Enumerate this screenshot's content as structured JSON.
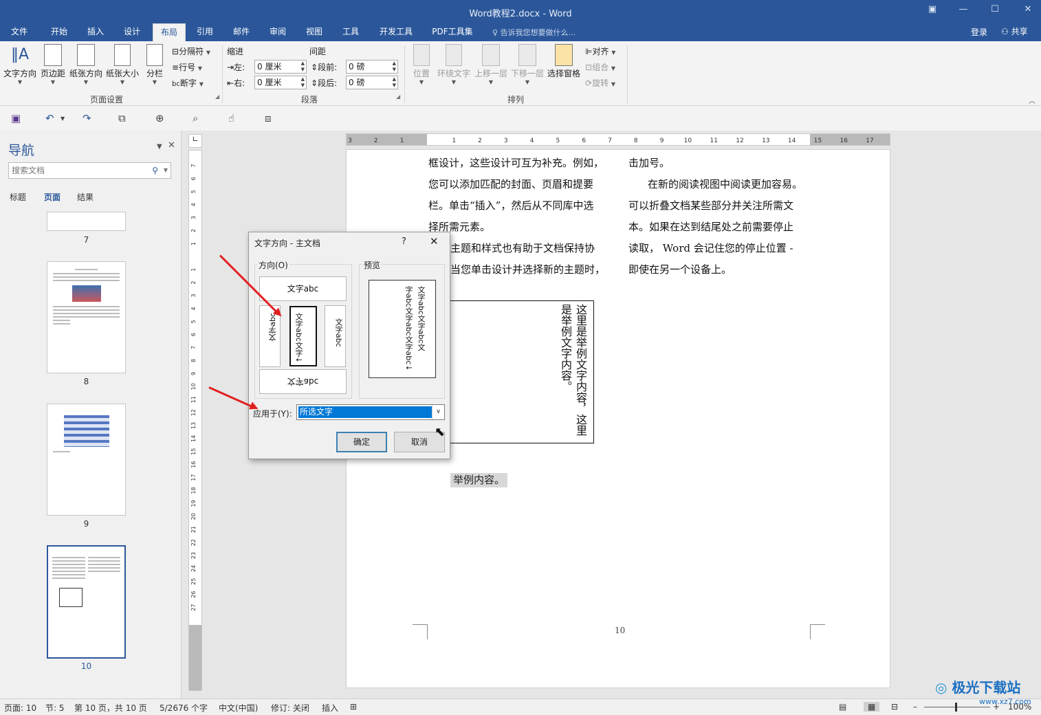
{
  "window": {
    "title": "Word教程2.docx - Word"
  },
  "tabs": [
    "文件",
    "开始",
    "插入",
    "设计",
    "布局",
    "引用",
    "邮件",
    "审阅",
    "视图",
    "工具",
    "开发工具",
    "PDF工具集"
  ],
  "tell_me": "告诉我您想要做什么...",
  "signin": "登录",
  "share": "共享",
  "ribbon": {
    "page_setup": {
      "text_direction": "文字方向",
      "margins": "页边距",
      "orientation": "纸张方向",
      "size": "纸张大小",
      "columns": "分栏",
      "breaks": "分隔符",
      "line_numbers": "行号",
      "hyphenation": "断字",
      "group": "页面设置"
    },
    "paragraph": {
      "indent": "缩进",
      "spacing": "间距",
      "left": "左:",
      "right": "右:",
      "before": "段前:",
      "after": "段后:",
      "left_val": "0 厘米",
      "right_val": "0 厘米",
      "before_val": "0 磅",
      "after_val": "0 磅",
      "group": "段落"
    },
    "arrange": {
      "position": "位置",
      "wrap": "环绕文字",
      "forward": "上移一层",
      "backward": "下移一层",
      "selection_pane": "选择窗格",
      "align": "对齐",
      "group_btn": "组合",
      "rotate": "旋转",
      "group": "排列"
    }
  },
  "nav": {
    "title": "导航",
    "search_placeholder": "搜索文档",
    "tabs": [
      "标题",
      "页面",
      "结果"
    ],
    "pages": [
      "7",
      "8",
      "9",
      "10"
    ]
  },
  "document": {
    "col1": [
      "框设计，这些设计可互为补充。例如，",
      "您可以添加匹配的封面、页眉和提要",
      "栏。单击“插入”，然后从不同库中选",
      "择所需元素。",
      "主题和样式也有助于文档保持协",
      "当您单击设计并选择新的主题时，"
    ],
    "col2": [
      "击加号。",
      "在新的阅读视图中阅读更加容易。",
      "可以折叠文档某些部分并关注所需文",
      "本。如果在达到结尾处之前需要停止",
      "读取， Word 会记住您的停止位置 -",
      "即使在另一个设备上。"
    ],
    "textbox_col1": "这里是举例文字内容，这里",
    "textbox_col2": "是举例文字内容。",
    "selected": "举例内容。",
    "page_number": "10"
  },
  "dialog": {
    "title": "文字方向 - 主文档",
    "help": "?",
    "orientation_label": "方向(O)",
    "preview_label": "预览",
    "opt_horizontal": "文字abc",
    "opt_rot_left": "文字abc",
    "opt_vertical": "文字abc文字↓",
    "opt_rot_right": "文字abc",
    "opt_flip": "文字abc",
    "preview_line1": "文字abc文字abc文",
    "preview_line2": "字abc文字abc文字abc↓",
    "apply_label": "应用于(Y):",
    "apply_value": "所选文字",
    "ok": "确定",
    "cancel": "取消"
  },
  "ruler": {
    "h": [
      "3",
      "2",
      "1",
      "",
      "1",
      "2",
      "3",
      "4",
      "5",
      "6",
      "7",
      "8",
      "9",
      "10",
      "11",
      "12",
      "13",
      "14",
      "15",
      "16",
      "17"
    ],
    "v": [
      "7",
      "6",
      "5",
      "4",
      "3",
      "2",
      "1",
      "",
      "1",
      "2",
      "3",
      "4",
      "5",
      "6",
      "7",
      "8",
      "9",
      "10",
      "11",
      "12",
      "13",
      "14",
      "15",
      "16",
      "17",
      "18",
      "19",
      "20",
      "21",
      "22",
      "23",
      "24",
      "25",
      "26",
      "27"
    ]
  },
  "status": {
    "page": "页面: 10",
    "section": "节: 5",
    "pages": "第 10 页，共 10 页",
    "words": "5/2676 个字",
    "lang": "中文(中国)",
    "track": "修订: 关闭",
    "insert": "插入",
    "zoom": "100%"
  },
  "watermark": {
    "name": "极光下载站",
    "url": "www.xz7.com"
  },
  "colors": {
    "accent": "#2b579a",
    "selection": "#0078d7",
    "annotation": "#e02020"
  }
}
